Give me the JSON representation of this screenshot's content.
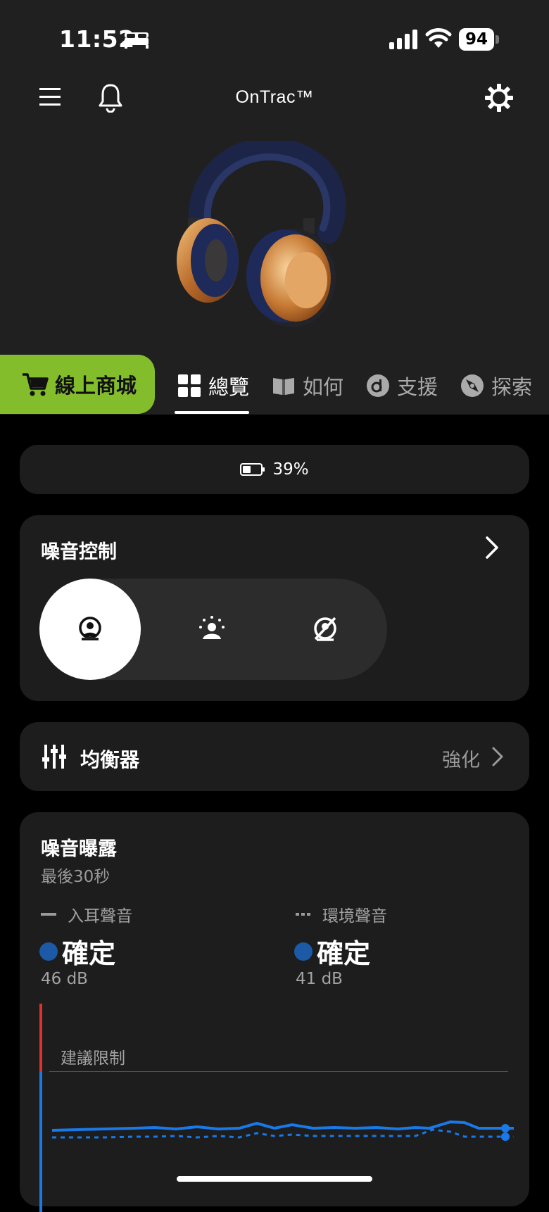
{
  "status_bar": {
    "time": "11:52",
    "battery": "94"
  },
  "header": {
    "title": "OnTrac™"
  },
  "shop": {
    "label": "線上商城"
  },
  "tabs": [
    {
      "label": "總覽",
      "icon": "grid-icon",
      "active": true
    },
    {
      "label": "如何",
      "icon": "book-icon",
      "active": false
    },
    {
      "label": "支援",
      "icon": "support-icon",
      "active": false
    },
    {
      "label": "探索",
      "icon": "explore-icon",
      "active": false
    }
  ],
  "battery_card": {
    "level": "39%"
  },
  "noise_control": {
    "title": "噪音控制",
    "modes": [
      "anc-icon",
      "transparency-icon",
      "off-icon"
    ],
    "selected_index": 0
  },
  "equalizer": {
    "title": "均衡器",
    "value": "強化"
  },
  "noise_exposure": {
    "title": "噪音曝露",
    "subtitle": "最後30秒",
    "in_ear": {
      "legend": "入耳聲音",
      "status": "確定",
      "db": "46 dB"
    },
    "ambient": {
      "legend": "環境聲音",
      "status": "確定",
      "db": "41 dB"
    },
    "limit_label": "建議限制"
  },
  "colors": {
    "accent_green": "#83bd2b",
    "status_blue": "#1c5aa8",
    "line_blue": "#1979e6",
    "limit_red": "#e0312a"
  }
}
